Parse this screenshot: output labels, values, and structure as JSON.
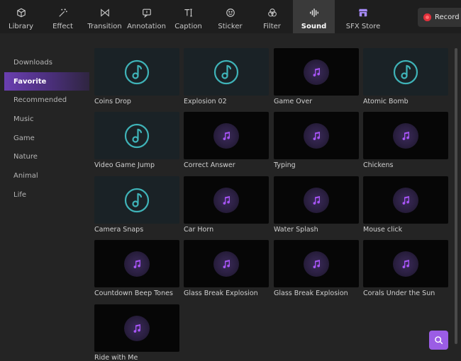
{
  "toolbar": {
    "tabs": [
      {
        "label": "Library",
        "icon": "cube-icon"
      },
      {
        "label": "Effect",
        "icon": "magic-wand-icon"
      },
      {
        "label": "Transition",
        "icon": "bowtie-icon"
      },
      {
        "label": "Annotation",
        "icon": "chat-bubble-icon"
      },
      {
        "label": "Caption",
        "icon": "text-cursor-icon"
      },
      {
        "label": "Sticker",
        "icon": "smiley-icon"
      },
      {
        "label": "Filter",
        "icon": "circles-icon"
      },
      {
        "label": "Sound",
        "icon": "waveform-icon",
        "active": true
      },
      {
        "label": "SFX Store",
        "icon": "store-icon"
      }
    ],
    "record_label": "Record"
  },
  "sidebar": {
    "items": [
      {
        "label": "Downloads"
      },
      {
        "label": "Favorite",
        "active": true
      },
      {
        "label": "Recommended"
      },
      {
        "label": "Music"
      },
      {
        "label": "Game"
      },
      {
        "label": "Nature"
      },
      {
        "label": "Animal"
      },
      {
        "label": "Life"
      }
    ]
  },
  "sounds": [
    {
      "name": "Coins Drop",
      "style": "teal"
    },
    {
      "name": "Explosion 02",
      "style": "teal"
    },
    {
      "name": "Game Over",
      "style": "dark"
    },
    {
      "name": "Atomic Bomb",
      "style": "teal"
    },
    {
      "name": "Video Game Jump",
      "style": "teal"
    },
    {
      "name": "Correct Answer",
      "style": "dark"
    },
    {
      "name": "Typing",
      "style": "dark"
    },
    {
      "name": "Chickens",
      "style": "dark"
    },
    {
      "name": "Camera Snaps",
      "style": "teal"
    },
    {
      "name": "Car Horn",
      "style": "dark"
    },
    {
      "name": "Water Splash",
      "style": "dark"
    },
    {
      "name": "Mouse click",
      "style": "dark"
    },
    {
      "name": "Countdown Beep Tones",
      "style": "dark"
    },
    {
      "name": "Glass Break Explosion",
      "style": "dark"
    },
    {
      "name": "Glass Break Explosion",
      "style": "dark"
    },
    {
      "name": "Corals Under the Sun",
      "style": "dark"
    },
    {
      "name": "Ride with Me",
      "style": "dark"
    }
  ],
  "colors": {
    "accent": "#9b5de5",
    "teal_disc": "#3fb3b8",
    "note_purple": "#a855f7",
    "record_red": "#e0303c"
  }
}
